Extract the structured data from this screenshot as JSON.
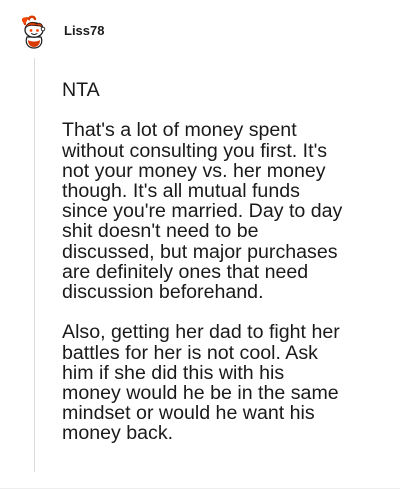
{
  "comment": {
    "username": "Liss78",
    "paragraphs": [
      "NTA",
      "That's a lot of money spent\nwithout consulting you first. It's\nnot your money vs. her money\nthough. It's all mutual funds\nsince you're married. Day to day\nshit doesn't need to be\ndiscussed, but major purchases\nare definitely ones that need\ndiscussion beforehand.",
      "Also, getting her dad to fight her\nbattles for her is not cool. Ask\nhim if she did this with his\nmoney would he be in the same\nmindset or would he want his\nmoney back."
    ]
  },
  "avatar": {
    "icon": "snoo-avatar-icon",
    "colors": {
      "primary": "#d93a00",
      "head": "#ffffff",
      "outline": "#1c1c1c",
      "accent": "#ff4500"
    }
  },
  "colors": {
    "text": "#1a1a1b",
    "username": "#1c1c1c",
    "thread_line": "#d8dde0"
  }
}
